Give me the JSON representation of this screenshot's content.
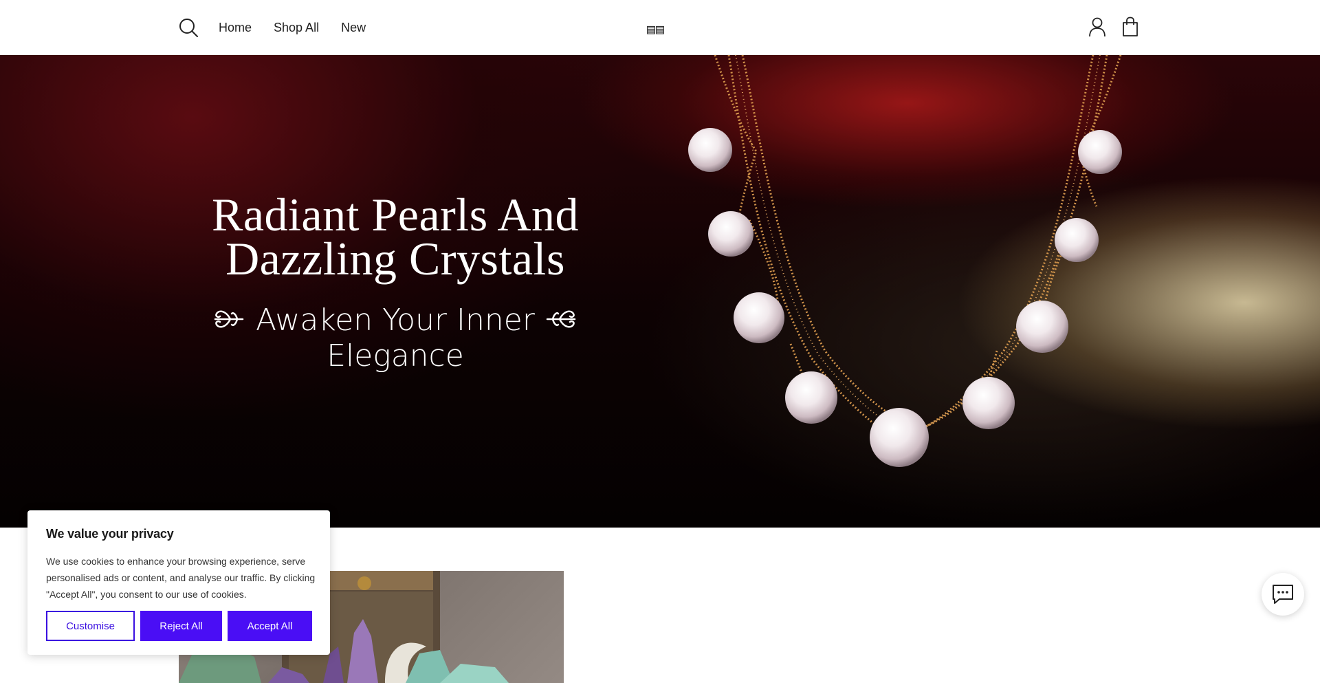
{
  "header": {
    "nav": [
      "Home",
      "Shop All",
      "New"
    ],
    "logo_text": "▤▤",
    "icons": [
      "search-icon",
      "account-icon",
      "cart-icon"
    ]
  },
  "hero": {
    "title_line1": "Radiant Pearls And",
    "title_line2": "Dazzling Crystals",
    "subtitle_line1": "Awaken Your Inner",
    "subtitle_line2": "Elegance"
  },
  "cookie": {
    "title": "We value your privacy",
    "body": "We use cookies to enhance your browsing experience, serve personalised ads or content, and analyse our traffic. By clicking \"Accept All\", you consent to our use of cookies.",
    "customise": "Customise",
    "reject": "Reject All",
    "accept": "Accept All",
    "accent_color": "#4a0ef5"
  },
  "chat": {
    "icon": "chat-icon"
  }
}
